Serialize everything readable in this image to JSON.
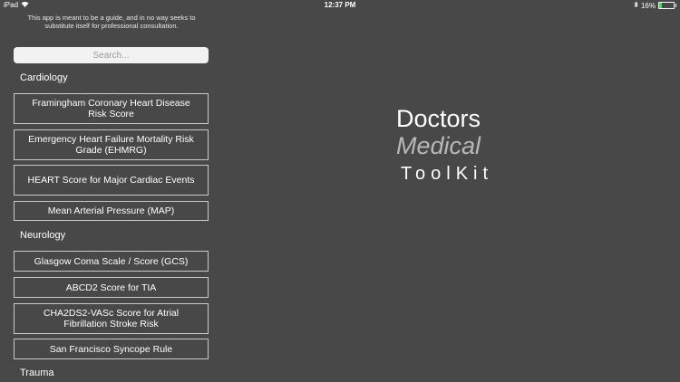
{
  "status_bar": {
    "device": "iPad",
    "time": "12:37 PM",
    "battery_text": "16%",
    "battery_level": 0.16
  },
  "disclaimer": "This app is meant to be a guide, and in no way seeks to substitute itself for professional consultation.",
  "search": {
    "placeholder": "Search..."
  },
  "sections": [
    {
      "header": "Cardiology",
      "items": [
        "Framingham Coronary Heart Disease Risk Score",
        "Emergency Heart Failure Mortality Risk Grade (EHMRG)",
        "HEART Score for Major Cardiac Events",
        "Mean Arterial Pressure (MAP)"
      ]
    },
    {
      "header": "Neurology",
      "items": [
        "Glasgow Coma Scale / Score (GCS)",
        "ABCD2 Score for TIA",
        "CHA2DS2-VASc Score for Atrial Fibrillation Stroke Risk",
        "San Francisco Syncope Rule"
      ]
    },
    {
      "header": "Trauma",
      "items": []
    }
  ],
  "logo": {
    "line1": "Doctors",
    "line2": "Medical",
    "line3": "ToolKit"
  }
}
